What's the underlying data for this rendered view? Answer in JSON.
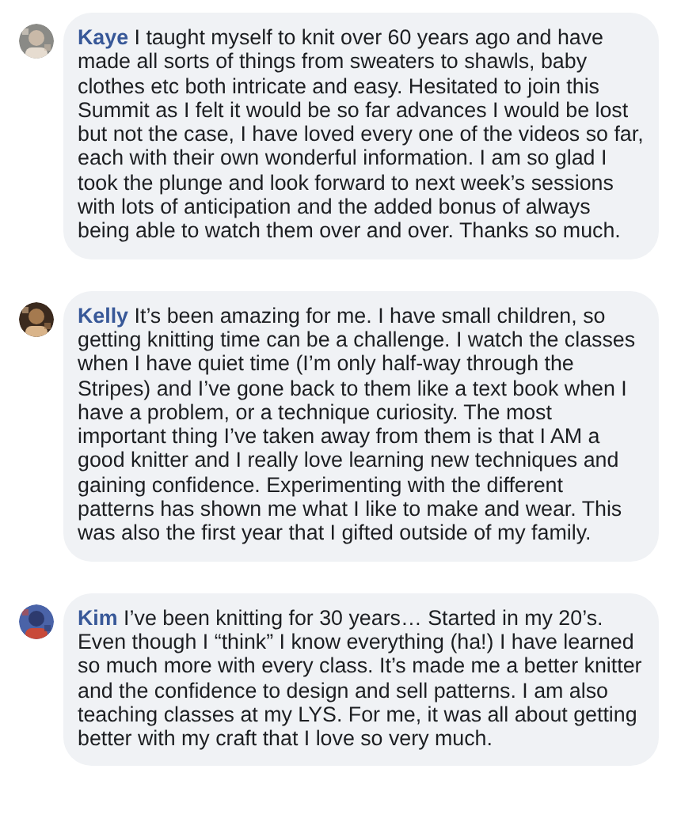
{
  "comments": [
    {
      "author": "Kaye",
      "text": "I taught myself to knit over 60 years ago and have made all sorts of things from sweaters to shawls, baby clothes etc both intricate and easy. Hesitated to join this Summit as I felt it would be so far advances I would be lost but not the case, I have loved every one of the videos so far, each with their own wonderful information. I am so glad I took the plunge and look forward to next week’s sessions with lots of anticipation and the added bonus of always being able to watch them over and over. Thanks so much."
    },
    {
      "author": "Kelly",
      "text": "It’s been amazing for me. I have small children, so getting knitting time can be a challenge. I watch the classes when I have quiet time (I’m only half-way through the Stripes) and I’ve gone back to them like a text book when I have a problem, or a technique curiosity. The most important thing I’ve taken away from them is that I AM a good knitter and I really love learning new techniques and gaining confidence. Experimenting with the different patterns has shown me what I like to make and wear. This was also the first year that I gifted outside of my family."
    },
    {
      "author": "Kim",
      "text": "I’ve been knitting for 30 years… Started in my 20’s. Even though I “think” I know everything (ha!) I have learned so much more with every class. It’s made me a better knitter and the confidence to design and sell patterns. I am also teaching classes at my LYS. For me, it was all about getting better with my craft that I love so very much."
    }
  ]
}
